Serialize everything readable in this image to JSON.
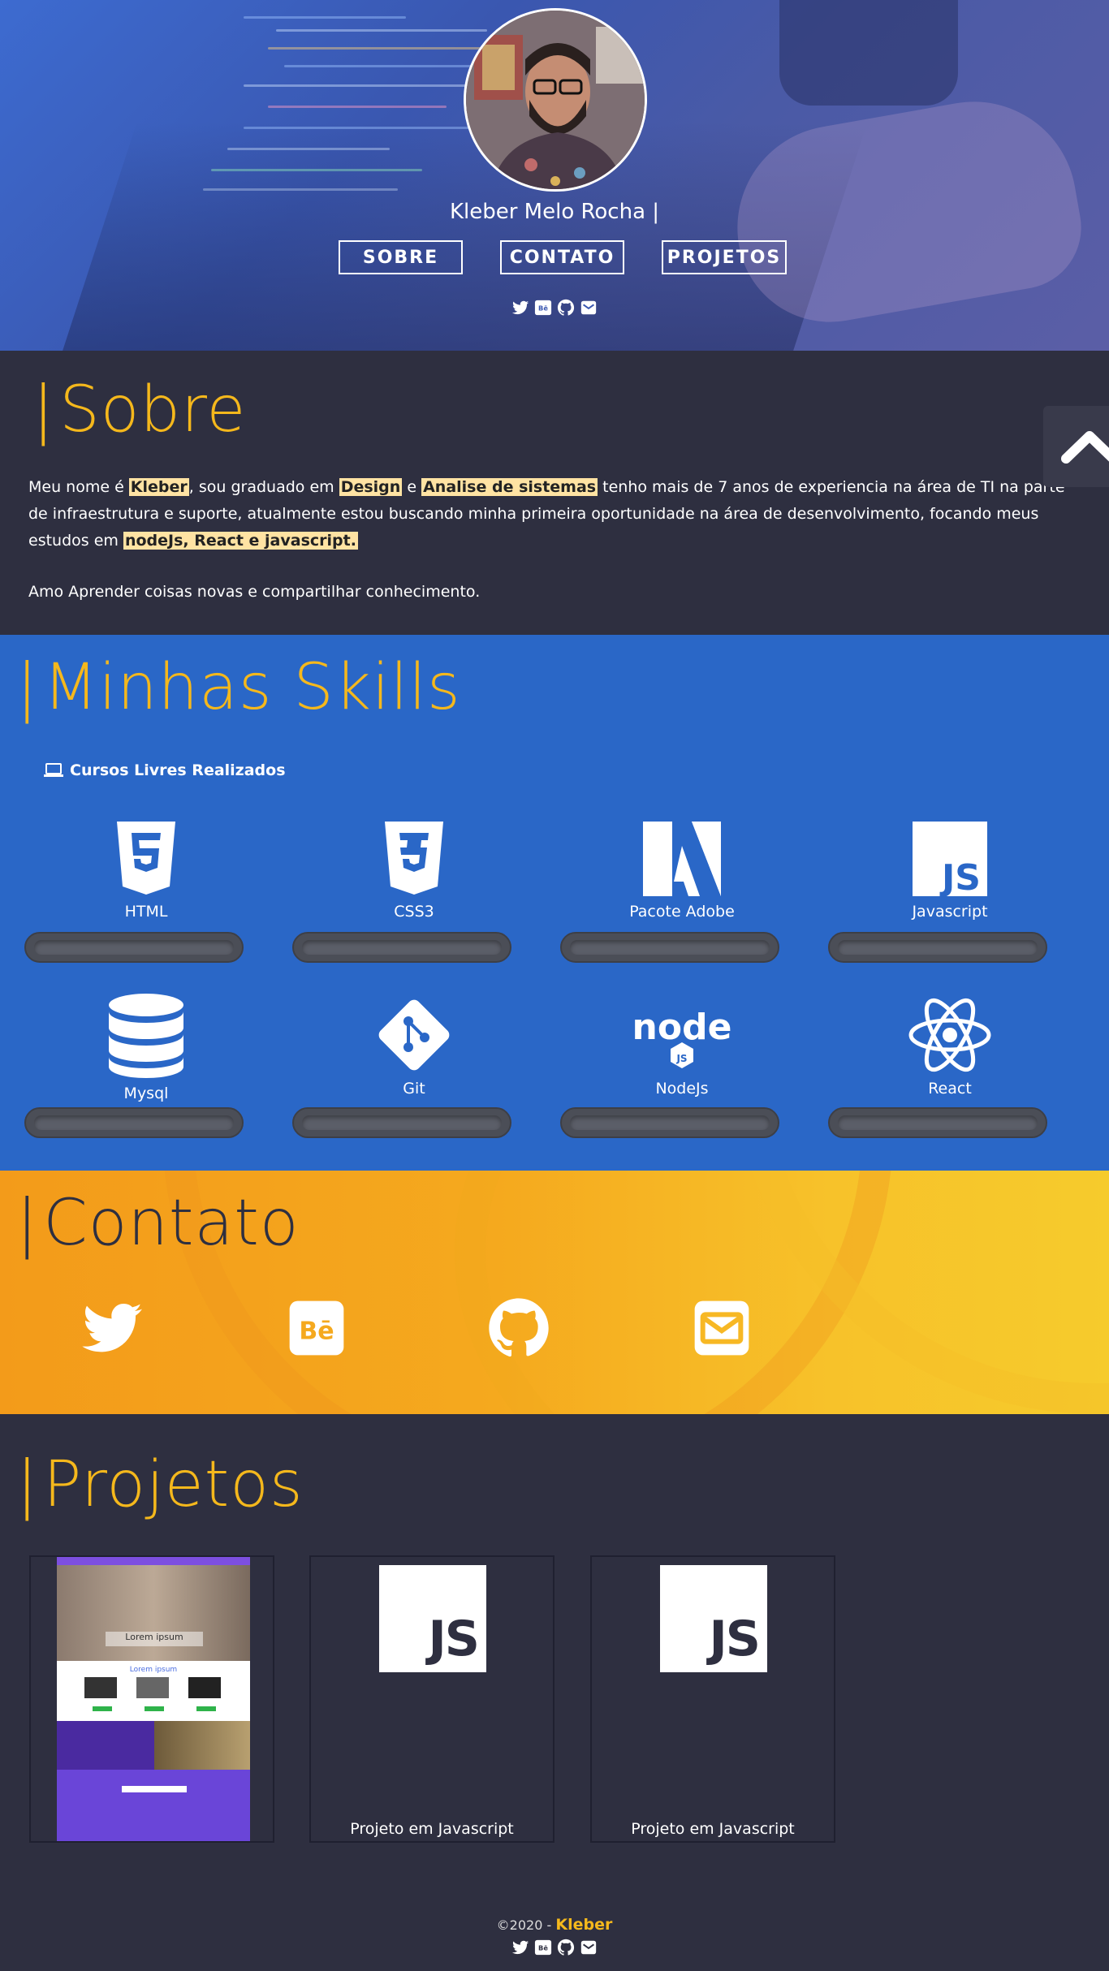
{
  "header": {
    "name": "Kleber Melo Rocha |",
    "nav": [
      "SOBRE",
      "CONTATO",
      "PROJETOS"
    ],
    "social_icons": [
      "twitter-icon",
      "behance-icon",
      "github-icon",
      "email-icon"
    ]
  },
  "sobre": {
    "title_bar": "|",
    "title": "Sobre",
    "p1_a": "Meu nome é ",
    "p1_kleber": "Kleber",
    "p1_b": ", sou graduado em ",
    "p1_design": "Design",
    "p1_c": " e ",
    "p1_analise": "Analise de sistemas",
    "p1_d": " tenho mais de 7 anos de experiencia na área de TI na parte de infraestrutura e suporte, atualmente estou buscando minha primeira oportunidade na área de desenvolvimento, focando meus estudos em ",
    "p1_stack": "nodeJs, React e javascript.",
    "p2": "Amo Aprender coisas novas e compartilhar conhecimento."
  },
  "skills": {
    "title_bar": "|",
    "title": "Minhas Skills",
    "courses": "Cursos Livres Realizados",
    "items": [
      {
        "label": "HTML",
        "icon": "html5-icon"
      },
      {
        "label": "CSS3",
        "icon": "css3-icon"
      },
      {
        "label": "Pacote Adobe",
        "icon": "adobe-icon"
      },
      {
        "label": "Javascript",
        "icon": "javascript-icon"
      },
      {
        "label": "Mysql",
        "icon": "database-icon"
      },
      {
        "label": "Git",
        "icon": "git-icon"
      },
      {
        "label": "NodeJs",
        "icon": "nodejs-icon"
      },
      {
        "label": "React",
        "icon": "react-icon"
      }
    ]
  },
  "contato": {
    "title_bar": "|",
    "title": "Contato",
    "icons": [
      "twitter-icon",
      "behance-icon",
      "github-icon",
      "email-icon"
    ]
  },
  "projetos": {
    "title_bar": "|",
    "title": "Projetos",
    "items": [
      {
        "caption": "",
        "thumb": "website-screenshot"
      },
      {
        "caption": "Projeto em Javascript",
        "thumb_text": "JS"
      },
      {
        "caption": "Projeto em Javascript",
        "thumb_text": "JS"
      }
    ],
    "thumb_banner": "Lorem ipsum",
    "thumb_section": "Lorem ipsum"
  },
  "footer": {
    "copy": "©2020 - ",
    "brand": "Kleber"
  },
  "colors": {
    "accent": "#f5b81c",
    "dark": "#2e2f40",
    "blue": "#2a67c7",
    "highlight": "#ffe3a3"
  }
}
